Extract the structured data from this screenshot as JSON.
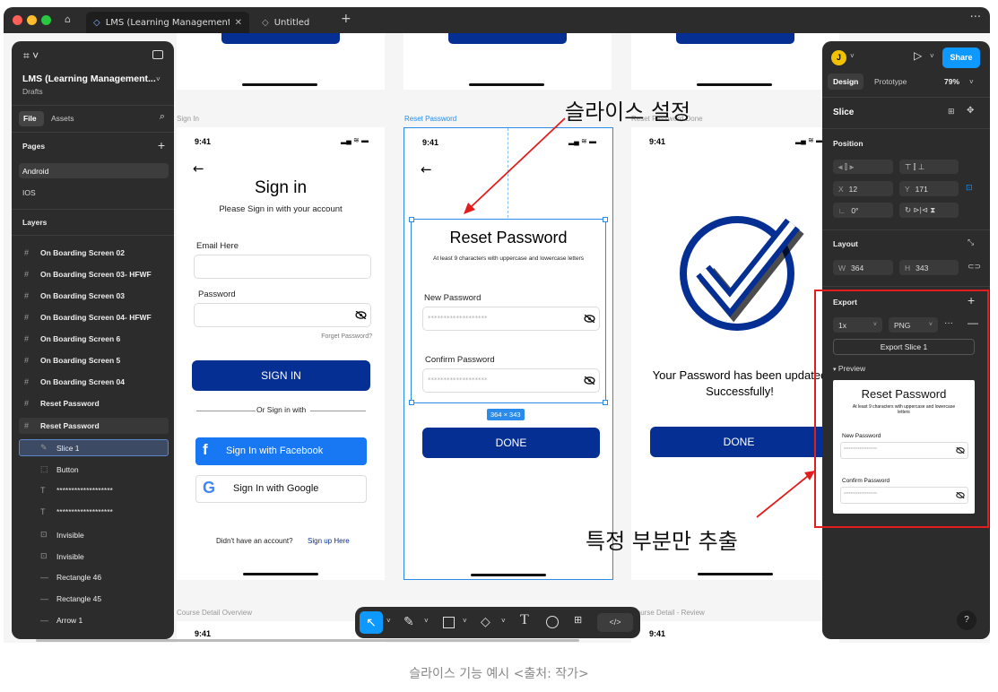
{
  "browser": {
    "tabs": [
      {
        "label": "LMS (Learning Management Syst"
      },
      {
        "label": "Untitled"
      }
    ]
  },
  "left_panel": {
    "file_title": "LMS (Learning Management...",
    "file_location": "Drafts",
    "tabs": [
      "File",
      "Assets"
    ],
    "pages_label": "Pages",
    "pages": [
      "Android",
      "IOS"
    ],
    "layers_label": "Layers",
    "layers": [
      "On Boarding Screen 02",
      "On Boarding Screen 03- HFWF",
      "On Boarding Screen 03",
      "On Boarding Screen 04- HFWF",
      "On Boarding Screen 6",
      "On Boarding Screen 5",
      "On Boarding Screen 04",
      "Reset Password",
      "Reset Password"
    ],
    "children": [
      "Slice 1",
      "Button",
      "*******************",
      "*******************",
      "Invisible",
      "Invisible",
      "Rectangle 46",
      "Rectangle 45",
      "Arrow 1"
    ]
  },
  "canvas": {
    "frame_labels": {
      "sign_in": "Sign In",
      "reset": "Reset Password",
      "reset_done": "Reset Password Done",
      "course_overview": "Course Detail Overview",
      "course_review": "Course Detail - Review"
    },
    "status_time": "9:41",
    "signin": {
      "title": "Sign in",
      "subtitle": "Please Sign in with your account",
      "email_label": "Email Here",
      "password_label": "Password",
      "forget": "Forget Password?",
      "button": "SIGN IN",
      "or": "Or Sign in with",
      "facebook": "Sign In with Facebook",
      "google": "Sign In with Google",
      "no_account": "Didn't have an account?",
      "signup": "Sign up Here"
    },
    "reset": {
      "title": "Reset Password",
      "subtitle": "At least 9 characters with uppercase and lowercase letters",
      "new_label": "New Password",
      "confirm_label": "Confirm Password",
      "placeholder": "*******************",
      "button": "DONE",
      "size_badge": "364 × 343"
    },
    "done": {
      "message": "Your Password has been updated Successfully!",
      "button": "DONE"
    },
    "annotation_top": "슬라이스 설정",
    "annotation_bottom": "특정 부분만 추출"
  },
  "toolbar": {
    "code_label": "</>"
  },
  "right_panel": {
    "avatar": "J",
    "share": "Share",
    "tabs": [
      "Design",
      "Prototype"
    ],
    "zoom": "79%",
    "section_title": "Slice",
    "position_label": "Position",
    "x_label": "X",
    "x_value": "12",
    "y_label": "Y",
    "y_value": "171",
    "rotation": "0°",
    "layout_label": "Layout",
    "w_label": "W",
    "w_value": "364",
    "h_label": "H",
    "h_value": "343",
    "export_label": "Export",
    "scale": "1x",
    "format": "PNG",
    "export_button": "Export Slice 1",
    "preview_label": "Preview",
    "help": "?"
  },
  "caption": "슬라이스 기능 예시 <출처: 작가>",
  "colors": {
    "brand_blue": "#062f94",
    "selection_blue": "#2a8bea",
    "annotation_red": "#e11d1d",
    "panel_bg": "#2c2c2c",
    "facebook": "#1877f2"
  }
}
